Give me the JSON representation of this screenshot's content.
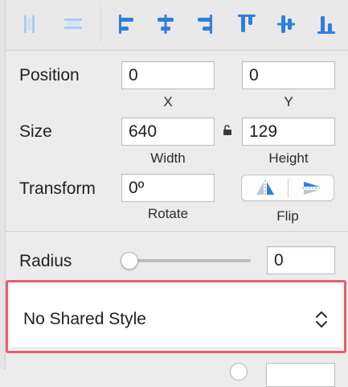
{
  "toolbar": {
    "buttons": [
      {
        "name": "distribute-horizontal-icon"
      },
      {
        "name": "distribute-vertical-icon"
      },
      {
        "name": "align-left-icon"
      },
      {
        "name": "align-center-horizontal-icon"
      },
      {
        "name": "align-right-icon"
      },
      {
        "name": "align-top-icon"
      },
      {
        "name": "align-middle-vertical-icon"
      },
      {
        "name": "align-bottom-icon"
      }
    ],
    "colors": {
      "active": "#2f7fdc",
      "inactive": "#a9cdf2"
    }
  },
  "position": {
    "label": "Position",
    "x": {
      "value": "0",
      "caption": "X"
    },
    "y": {
      "value": "0",
      "caption": "Y"
    }
  },
  "size": {
    "label": "Size",
    "width": {
      "value": "640",
      "caption": "Width"
    },
    "height": {
      "value": "129",
      "caption": "Height"
    },
    "lock_icon": "lock-icon"
  },
  "transform": {
    "label": "Transform",
    "rotate": {
      "value": "0º",
      "caption": "Rotate"
    },
    "flip": {
      "caption": "Flip",
      "icons": [
        "flip-horizontal-icon",
        "flip-vertical-icon"
      ]
    }
  },
  "radius": {
    "label": "Radius",
    "value": "0",
    "slider_fraction": 0
  },
  "shared_style": {
    "selected": "No Shared Style",
    "highlight_color": "#e75e6e"
  }
}
